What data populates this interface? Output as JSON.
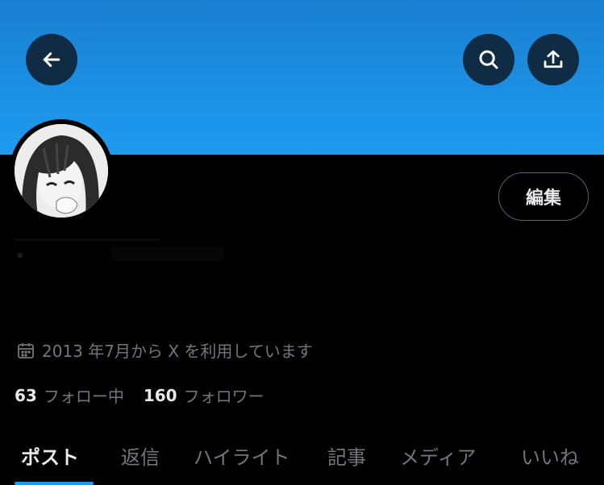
{
  "header": {
    "back_icon": "arrow-left-icon",
    "search_icon": "search-icon",
    "share_icon": "share-icon",
    "banner_color": "#1d9bf0"
  },
  "profile": {
    "edit_label": "編集",
    "joined_icon": "calendar-icon",
    "joined_text": "2013 年7月から X を利用しています",
    "following_count": "63",
    "following_label": "フォロー中",
    "followers_count": "160",
    "followers_label": "フォロワー"
  },
  "tabs": [
    {
      "label": "ポスト",
      "active": true
    },
    {
      "label": "返信",
      "active": false
    },
    {
      "label": "ハイライト",
      "active": false
    },
    {
      "label": "記事",
      "active": false
    },
    {
      "label": "メディア",
      "active": false
    },
    {
      "label": "いいね",
      "active": false
    }
  ],
  "colors": {
    "accent": "#1d9bf0",
    "muted_text": "#71767b",
    "primary_text": "#e7e9ea"
  }
}
